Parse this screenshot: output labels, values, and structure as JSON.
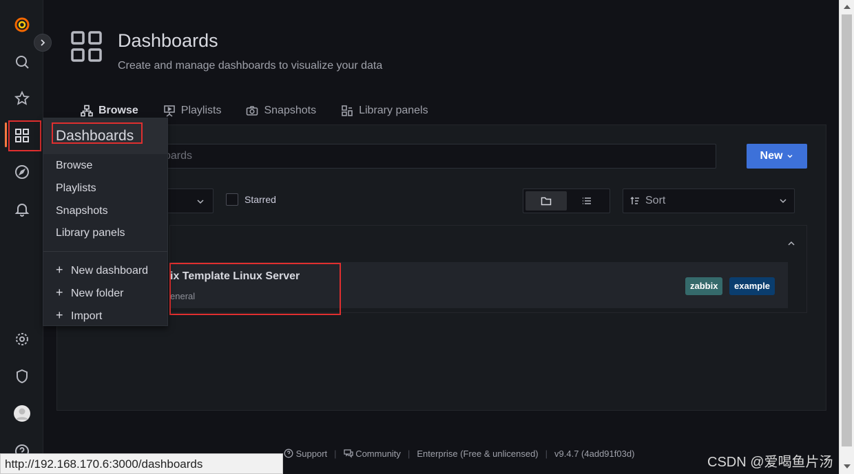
{
  "sidebar": {
    "icons": [
      "grafana-logo-icon",
      "search-icon",
      "star-icon",
      "dashboards-icon",
      "explore-icon",
      "alerting-icon",
      "settings-icon",
      "shield-icon",
      "avatar",
      "help-icon"
    ]
  },
  "header": {
    "title": "Dashboards",
    "subtitle": "Create and manage dashboards to visualize your data"
  },
  "tabs": [
    {
      "label": "Browse",
      "icon": "hierarchy-icon",
      "active": true
    },
    {
      "label": "Playlists",
      "icon": "presentation-icon",
      "active": false
    },
    {
      "label": "Snapshots",
      "icon": "camera-icon",
      "active": false
    },
    {
      "label": "Library panels",
      "icon": "library-icon",
      "active": false
    }
  ],
  "search": {
    "visible_text": "oards"
  },
  "new_button": {
    "label": "New"
  },
  "filters": {
    "starred_label": "Starred",
    "sort_label": "Sort"
  },
  "dashboard_list": {
    "item": {
      "name_visible": "ix Template Linux Server",
      "folder_visible": "eneral",
      "tags": [
        {
          "label": "zabbix",
          "color": "#356a6b"
        },
        {
          "label": "example",
          "color": "#0a3d6e"
        }
      ]
    }
  },
  "dropdown": {
    "title": "Dashboards",
    "items": [
      "Browse",
      "Playlists",
      "Snapshots",
      "Library panels"
    ],
    "actions": [
      "New dashboard",
      "New folder",
      "Import"
    ]
  },
  "footer": {
    "support": "Support",
    "community": "Community",
    "edition": "Enterprise (Free & unlicensed)",
    "version": "v9.4.7 (4add91f03d)"
  },
  "status_bar": {
    "url": "http://192.168.170.6:3000/dashboards"
  },
  "watermark": "CSDN @爱喝鱼片汤",
  "colors": {
    "accent": "#ff7941",
    "primary": "#3d71d9",
    "highlight": "#e02f2f"
  }
}
